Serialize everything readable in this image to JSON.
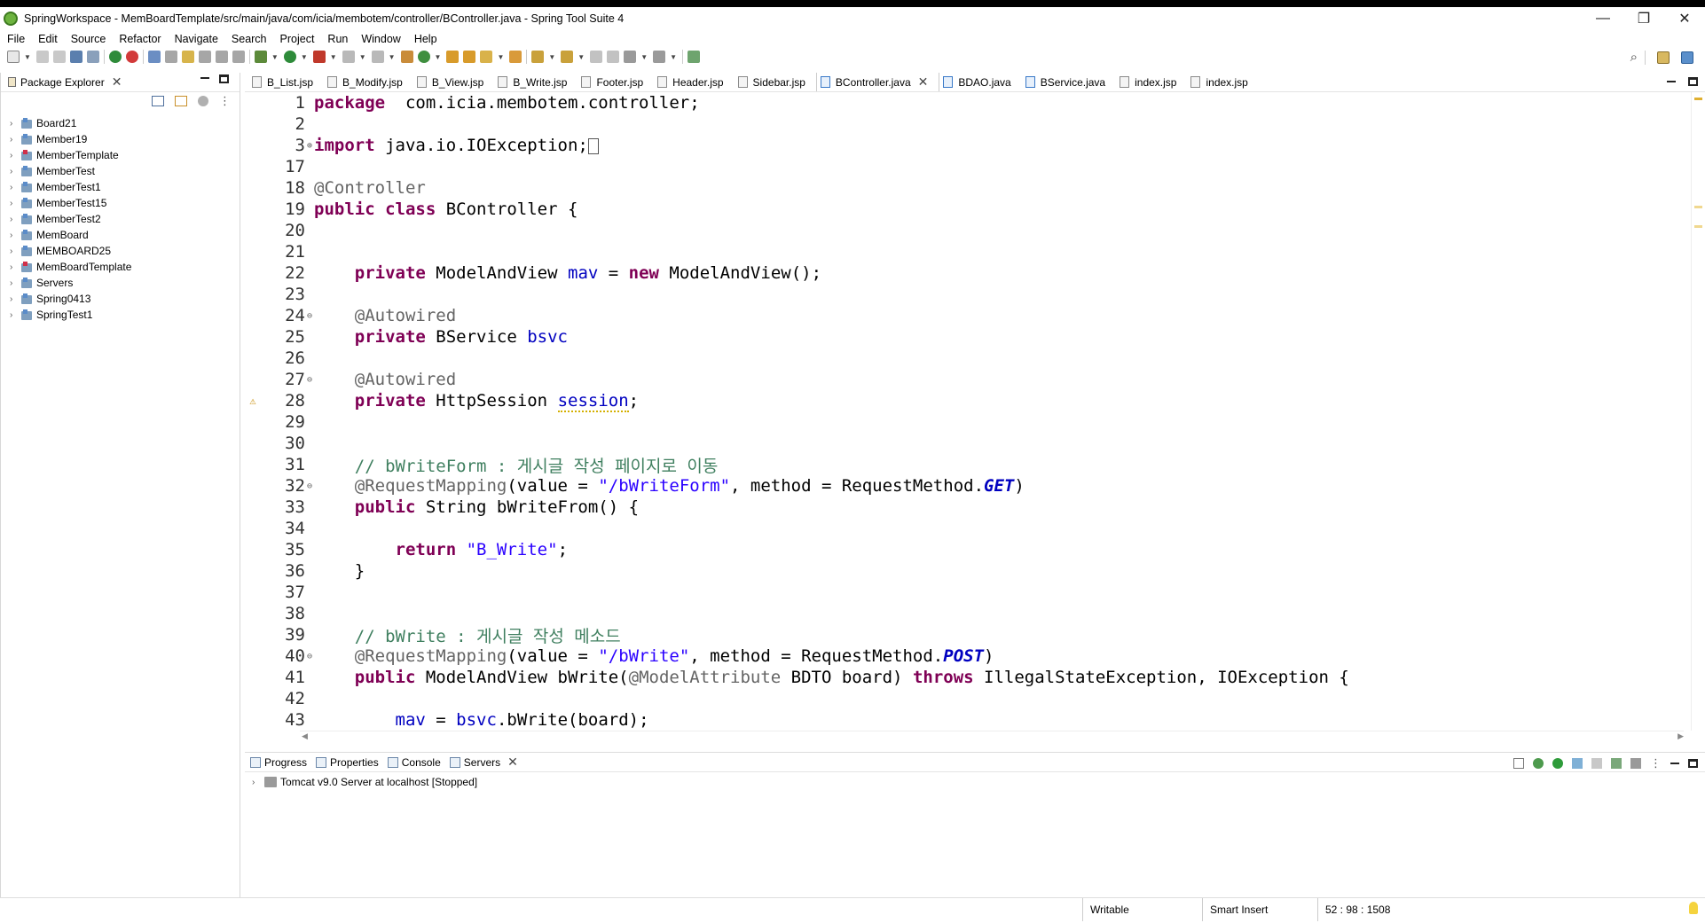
{
  "window": {
    "title": "SpringWorkspace - MemBoardTemplate/src/main/java/com/icia/membotem/controller/BController.java - Spring Tool Suite 4",
    "minimize": "—",
    "maximize": "❐",
    "close": "✕"
  },
  "menu": [
    "File",
    "Edit",
    "Source",
    "Refactor",
    "Navigate",
    "Search",
    "Project",
    "Run",
    "Window",
    "Help"
  ],
  "explorer": {
    "tab_label": "Package Explorer",
    "projects": [
      {
        "name": "Board21",
        "error": false
      },
      {
        "name": "Member19",
        "error": false
      },
      {
        "name": "MemberTemplate",
        "error": true
      },
      {
        "name": "MemberTest",
        "error": false
      },
      {
        "name": "MemberTest1",
        "error": false
      },
      {
        "name": "MemberTest15",
        "error": false
      },
      {
        "name": "MemberTest2",
        "error": false
      },
      {
        "name": "MemBoard",
        "error": false
      },
      {
        "name": "MEMBOARD25",
        "error": false
      },
      {
        "name": "MemBoardTemplate",
        "error": true
      },
      {
        "name": "Servers",
        "error": false
      },
      {
        "name": "Spring0413",
        "error": false
      },
      {
        "name": "SpringTest1",
        "error": false
      }
    ]
  },
  "editor": {
    "tabs": [
      {
        "label": "B_List.jsp",
        "type": "jsp",
        "active": false
      },
      {
        "label": "B_Modify.jsp",
        "type": "jsp",
        "active": false
      },
      {
        "label": "B_View.jsp",
        "type": "jsp",
        "active": false
      },
      {
        "label": "B_Write.jsp",
        "type": "jsp",
        "active": false
      },
      {
        "label": "Footer.jsp",
        "type": "jsp",
        "active": false
      },
      {
        "label": "Header.jsp",
        "type": "jsp",
        "active": false
      },
      {
        "label": "Sidebar.jsp",
        "type": "jsp",
        "active": false
      },
      {
        "label": "BController.java",
        "type": "java",
        "active": true
      },
      {
        "label": "BDAO.java",
        "type": "java",
        "active": false
      },
      {
        "label": "BService.java",
        "type": "java",
        "active": false
      },
      {
        "label": "index.jsp",
        "type": "jsp",
        "active": false
      },
      {
        "label": "index.jsp",
        "type": "jsp",
        "active": false
      }
    ],
    "lines": [
      {
        "n": "1",
        "fold": "",
        "mark": "",
        "tokens": [
          [
            "kw",
            "package"
          ],
          [
            "",
            "  com.icia.membotem.controller;"
          ]
        ]
      },
      {
        "n": "2",
        "fold": "",
        "mark": "",
        "tokens": []
      },
      {
        "n": "3",
        "fold": "⊕",
        "mark": "",
        "tokens": [
          [
            "kw",
            "import"
          ],
          [
            "",
            " java.io.IOException;"
          ],
          [
            "box",
            ""
          ]
        ]
      },
      {
        "n": "17",
        "fold": "",
        "mark": "",
        "tokens": []
      },
      {
        "n": "18",
        "fold": "",
        "mark": "",
        "tokens": [
          [
            "ann",
            "@Controller"
          ]
        ]
      },
      {
        "n": "19",
        "fold": "",
        "mark": "",
        "tokens": [
          [
            "kw",
            "public"
          ],
          [
            "",
            " "
          ],
          [
            "kw",
            "class"
          ],
          [
            "",
            " BController {"
          ]
        ]
      },
      {
        "n": "20",
        "fold": "",
        "mark": "",
        "tokens": []
      },
      {
        "n": "21",
        "fold": "",
        "mark": "",
        "tokens": []
      },
      {
        "n": "22",
        "fold": "",
        "mark": "",
        "tokens": [
          [
            "",
            "    "
          ],
          [
            "kw",
            "private"
          ],
          [
            "",
            " ModelAndView "
          ],
          [
            "fld",
            "mav"
          ],
          [
            "",
            " = "
          ],
          [
            "kw",
            "new"
          ],
          [
            "",
            " ModelAndView();"
          ]
        ]
      },
      {
        "n": "23",
        "fold": "",
        "mark": "",
        "tokens": []
      },
      {
        "n": "24",
        "fold": "⊖",
        "mark": "",
        "tokens": [
          [
            "",
            "    "
          ],
          [
            "ann",
            "@Autowired"
          ]
        ]
      },
      {
        "n": "25",
        "fold": "",
        "mark": "",
        "tokens": [
          [
            "",
            "    "
          ],
          [
            "kw",
            "private"
          ],
          [
            "",
            " BService "
          ],
          [
            "fld",
            "bsvc"
          ],
          [
            ";"
          ]
        ]
      },
      {
        "n": "26",
        "fold": "",
        "mark": "",
        "tokens": []
      },
      {
        "n": "27",
        "fold": "⊖",
        "mark": "",
        "tokens": [
          [
            "",
            "    "
          ],
          [
            "ann",
            "@Autowired"
          ]
        ]
      },
      {
        "n": "28",
        "fold": "",
        "mark": "⚠",
        "tokens": [
          [
            "",
            "    "
          ],
          [
            "kw",
            "private"
          ],
          [
            "",
            " HttpSession "
          ],
          [
            "fldw",
            "session"
          ],
          [
            "",
            ";"
          ]
        ]
      },
      {
        "n": "29",
        "fold": "",
        "mark": "",
        "tokens": []
      },
      {
        "n": "30",
        "fold": "",
        "mark": "",
        "tokens": []
      },
      {
        "n": "31",
        "fold": "",
        "mark": "",
        "tokens": [
          [
            "",
            "    "
          ],
          [
            "cmt",
            "// bWriteForm : 게시글 작성 페이지로 이동"
          ]
        ]
      },
      {
        "n": "32",
        "fold": "⊖",
        "mark": "",
        "tokens": [
          [
            "",
            "    "
          ],
          [
            "ann",
            "@RequestMapping"
          ],
          [
            "",
            "(value = "
          ],
          [
            "str",
            "\"/bWriteForm\""
          ],
          [
            "",
            ", method = RequestMethod."
          ],
          [
            "ital",
            "GET"
          ],
          [
            "",
            ")"
          ]
        ]
      },
      {
        "n": "33",
        "fold": "",
        "mark": "",
        "tokens": [
          [
            "",
            "    "
          ],
          [
            "kw",
            "public"
          ],
          [
            "",
            " String bWriteFrom() {"
          ]
        ]
      },
      {
        "n": "34",
        "fold": "",
        "mark": "",
        "tokens": []
      },
      {
        "n": "35",
        "fold": "",
        "mark": "",
        "tokens": [
          [
            "",
            "        "
          ],
          [
            "kw",
            "return"
          ],
          [
            "",
            " "
          ],
          [
            "str",
            "\"B_Write\""
          ],
          [
            "",
            ";"
          ]
        ]
      },
      {
        "n": "36",
        "fold": "",
        "mark": "",
        "tokens": [
          [
            "",
            "    }"
          ]
        ]
      },
      {
        "n": "37",
        "fold": "",
        "mark": "",
        "tokens": []
      },
      {
        "n": "38",
        "fold": "",
        "mark": "",
        "tokens": []
      },
      {
        "n": "39",
        "fold": "",
        "mark": "",
        "tokens": [
          [
            "",
            "    "
          ],
          [
            "cmt",
            "// bWrite : 게시글 작성 메소드"
          ]
        ]
      },
      {
        "n": "40",
        "fold": "⊖",
        "mark": "",
        "tokens": [
          [
            "",
            "    "
          ],
          [
            "ann",
            "@RequestMapping"
          ],
          [
            "",
            "(value = "
          ],
          [
            "str",
            "\"/bWrite\""
          ],
          [
            "",
            ", method = RequestMethod."
          ],
          [
            "ital",
            "POST"
          ],
          [
            "",
            ")"
          ]
        ]
      },
      {
        "n": "41",
        "fold": "",
        "mark": "",
        "tokens": [
          [
            "",
            "    "
          ],
          [
            "kw",
            "public"
          ],
          [
            "",
            " ModelAndView bWrite("
          ],
          [
            "ann",
            "@ModelAttribute"
          ],
          [
            "",
            " BDTO board) "
          ],
          [
            "kw",
            "throws"
          ],
          [
            "",
            " IllegalStateException, IOException {"
          ]
        ]
      },
      {
        "n": "42",
        "fold": "",
        "mark": "",
        "tokens": []
      },
      {
        "n": "43",
        "fold": "",
        "mark": "",
        "tokens": [
          [
            "",
            "        "
          ],
          [
            "fld",
            "mav"
          ],
          [
            "",
            " = "
          ],
          [
            "fld",
            "bsvc"
          ],
          [
            "",
            ".bWrite(board);"
          ]
        ]
      }
    ]
  },
  "bottom_panel": {
    "tabs": [
      {
        "label": "Progress",
        "active": false,
        "closable": false
      },
      {
        "label": "Properties",
        "active": false,
        "closable": false
      },
      {
        "label": "Console",
        "active": false,
        "closable": false
      },
      {
        "label": "Servers",
        "active": true,
        "closable": true
      }
    ],
    "server": "Tomcat v9.0 Server at localhost  [Stopped]"
  },
  "status": {
    "writable": "Writable",
    "insert_mode": "Smart Insert",
    "position": "52 : 98 : 1508"
  },
  "colors": {
    "keyword": "#7f0055",
    "annotation": "#646464",
    "string": "#2a00ff",
    "comment": "#3f7f5f",
    "field": "#0000c0"
  }
}
